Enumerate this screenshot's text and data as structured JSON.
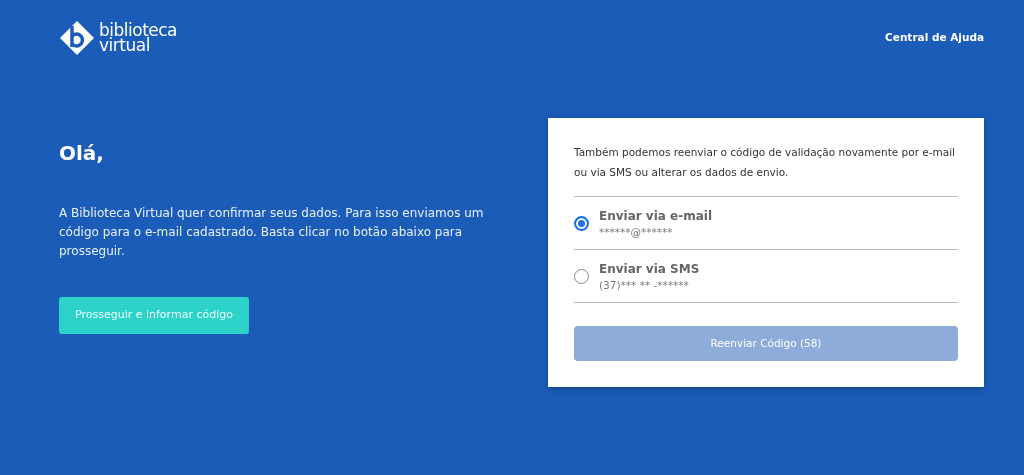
{
  "header": {
    "logo": {
      "line_1": "biblioteca",
      "line_2": "virtual"
    },
    "help_link": "Central de Ajuda"
  },
  "intro": {
    "heading": "Olá,",
    "text": "A Biblioteca Virtual quer confirmar seus dados. Para isso enviamos um código para o e-mail cadastrado. Basta clicar no botão abaixo para prosseguir.",
    "button": "Prosseguir e informar código"
  },
  "card": {
    "text": "Também podemos reenviar o código de validação novamente por e-mail ou via SMS ou alterar os dados de envio.",
    "options": [
      {
        "label": "Enviar via e-mail",
        "detail": "******@******",
        "selected": true
      },
      {
        "label": "Enviar via SMS",
        "detail": "(37)*** ** -******",
        "selected": false
      }
    ],
    "button": {
      "label": "Reenviar Código (58)",
      "disabled": true
    }
  }
}
